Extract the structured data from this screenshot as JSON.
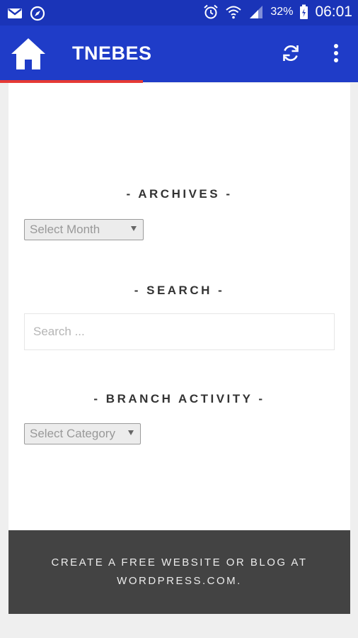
{
  "status_bar": {
    "battery_percent": "32%",
    "time": "06:01",
    "icons": [
      "gmail-icon",
      "compass-icon",
      "alarm-icon",
      "wifi-icon",
      "signal-icon",
      "battery-icon"
    ]
  },
  "app_bar": {
    "title": "TNEBES",
    "icons": [
      "home-icon",
      "refresh-icon",
      "overflow-menu-icon"
    ],
    "color": "#1f3cc8",
    "progress_fraction": 0.4
  },
  "widgets": {
    "archives": {
      "title": "- ARCHIVES -",
      "select_value": "Select Month"
    },
    "search": {
      "title": "- SEARCH -",
      "placeholder": "Search ..."
    },
    "branch_activity": {
      "title": "- BRANCH ACTIVITY -",
      "select_value": "Select Category"
    }
  },
  "footer": {
    "line1": "CREATE A FREE WEBSITE OR BLOG AT",
    "line2": "WORDPRESS.COM."
  }
}
